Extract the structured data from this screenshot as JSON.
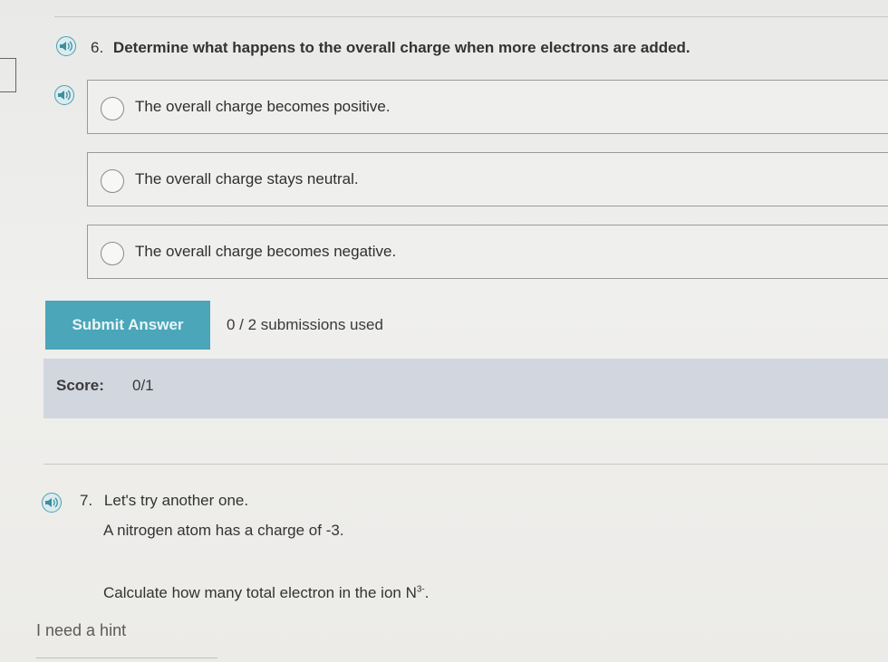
{
  "question6": {
    "number": "6.",
    "text": "Determine what happens to the overall charge when more electrons are added.",
    "options": [
      "The overall charge becomes positive.",
      "The overall charge stays neutral.",
      "The overall charge becomes negative."
    ],
    "submit_label": "Submit Answer",
    "submissions": "0 / 2 submissions used",
    "score_label": "Score:",
    "score_value": "0/1"
  },
  "question7": {
    "number": "7.",
    "intro": "Let's try another one.",
    "statement": "A nitrogen atom has a charge of -3.",
    "prompt": "Calculate how many total electron in the ion N",
    "ion_superscript": "3-",
    "prompt_end": "."
  },
  "hint_link": "I need a hint",
  "colors": {
    "accent": "#4aa6b8",
    "score_band": "#d2d6df",
    "speaker_ring": "#4aa0b0"
  },
  "icons": {
    "speaker": "speaker-icon",
    "radio": "radio-circle"
  }
}
